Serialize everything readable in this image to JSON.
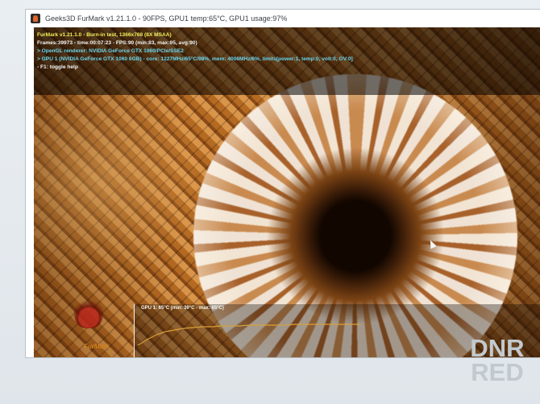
{
  "window": {
    "title": "Geeks3D FurMark v1.21.1.0 - 90FPS, GPU1 temp:65°C, GPU1 usage:97%"
  },
  "overlay": {
    "lines": [
      {
        "text": "FurMark v1.21.1.0 - Burn-in test, 1366x768 (8X MSAA)",
        "color": "#f0f05a"
      },
      {
        "text": "Frames:39973 - time:00:07:23 - FPS:90 (min:83, max:95, avg:90)",
        "color": "#f4f4f4"
      },
      {
        "text": "> OpenGL renderer: NVIDIA GeForce GTX 1060/PCIe/SSE2",
        "color": "#6ad7f0"
      },
      {
        "text": "> GPU 1 (NVIDIA GeForce GTX 1060 6GB) - core: 1227MHz/65°C/98%, mem: 4006MHz/6%, limits[power:1, temp:0, volt:0, OV:0]",
        "color": "#6ad7f0"
      },
      {
        "text": "- F1: toggle help",
        "color": "#f4f4f4"
      }
    ]
  },
  "graph": {
    "label": "GPU 1: 65°C (min: 39°C - max: 65°C)",
    "line_color": "#d8a13a",
    "temps": [
      39,
      46,
      52,
      56,
      58,
      60,
      61,
      62,
      62,
      63,
      63,
      63,
      64,
      64,
      64,
      64,
      64,
      65,
      65,
      65,
      65,
      65,
      65,
      65,
      65
    ]
  },
  "logo": {
    "text": "FurMark"
  },
  "watermark": {
    "line1": "DNR",
    "line2": "RED"
  }
}
